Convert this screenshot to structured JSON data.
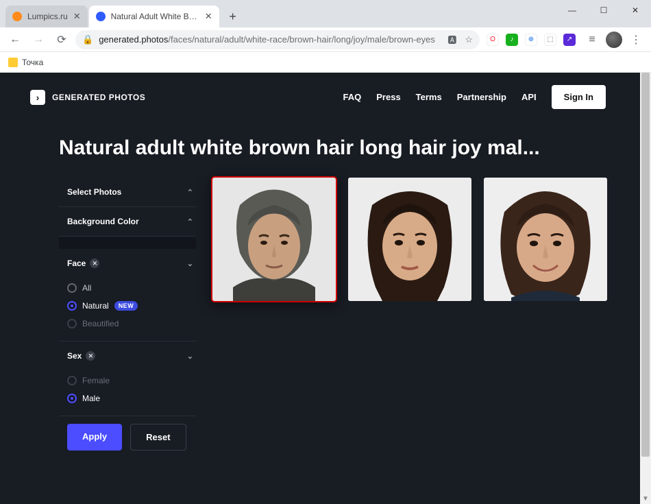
{
  "browser": {
    "tabs": [
      {
        "title": "Lumpics.ru",
        "active": false,
        "favicon": "#ff8c1a"
      },
      {
        "title": "Natural Adult White Brown Hair",
        "active": true,
        "favicon": "#2f5cff"
      }
    ],
    "window_buttons": {
      "minimize": "—",
      "maximize": "☐",
      "close": "✕"
    },
    "address": {
      "host": "generated.photos",
      "path": "/faces/natural/adult/white-race/brown-hair/long/joy/male/brown-eyes"
    },
    "bookmarks": [
      {
        "label": "Точка"
      }
    ],
    "extensions": [
      {
        "name": "translate-icon",
        "glyph": "⠿",
        "bg": "#ffffff",
        "fg": "#5f6368"
      },
      {
        "name": "opera-ext-icon",
        "glyph": "O",
        "bg": "#ffffff",
        "fg": "#ff1b2d"
      },
      {
        "name": "green-ext-icon",
        "glyph": "♪",
        "bg": "#17b01e",
        "fg": "#ffffff"
      },
      {
        "name": "globe-ext-icon",
        "glyph": "⊕",
        "bg": "#ffffff",
        "fg": "#1a73e8"
      },
      {
        "name": "cube-ext-icon",
        "glyph": "◍",
        "bg": "#ffffff",
        "fg": "#555"
      },
      {
        "name": "purple-ext-icon",
        "glyph": "↗",
        "bg": "#5b2bd9",
        "fg": "#ffffff"
      }
    ]
  },
  "site": {
    "logo_text": "GENERATED PHOTOS",
    "nav": [
      "FAQ",
      "Press",
      "Terms",
      "Partnership",
      "API"
    ],
    "signin": "Sign In"
  },
  "page_title": "Natural adult white brown hair long hair joy mal...",
  "sidebar": {
    "select_photos": "Select Photos",
    "background_color": "Background Color",
    "filters": [
      {
        "label": "Face",
        "clearable": true,
        "options": [
          {
            "label": "All",
            "selected": false
          },
          {
            "label": "Natural",
            "selected": true,
            "badge": "NEW"
          },
          {
            "label": "Beautified",
            "selected": false,
            "dim": true
          }
        ]
      },
      {
        "label": "Sex",
        "clearable": true,
        "options": [
          {
            "label": "Female",
            "selected": false,
            "dim": true
          },
          {
            "label": "Male",
            "selected": true
          }
        ]
      }
    ],
    "apply": "Apply",
    "reset": "Reset"
  },
  "results": [
    {
      "name": "result-photo-1",
      "highlight": true
    },
    {
      "name": "result-photo-2",
      "highlight": false
    },
    {
      "name": "result-photo-3",
      "highlight": false
    }
  ]
}
